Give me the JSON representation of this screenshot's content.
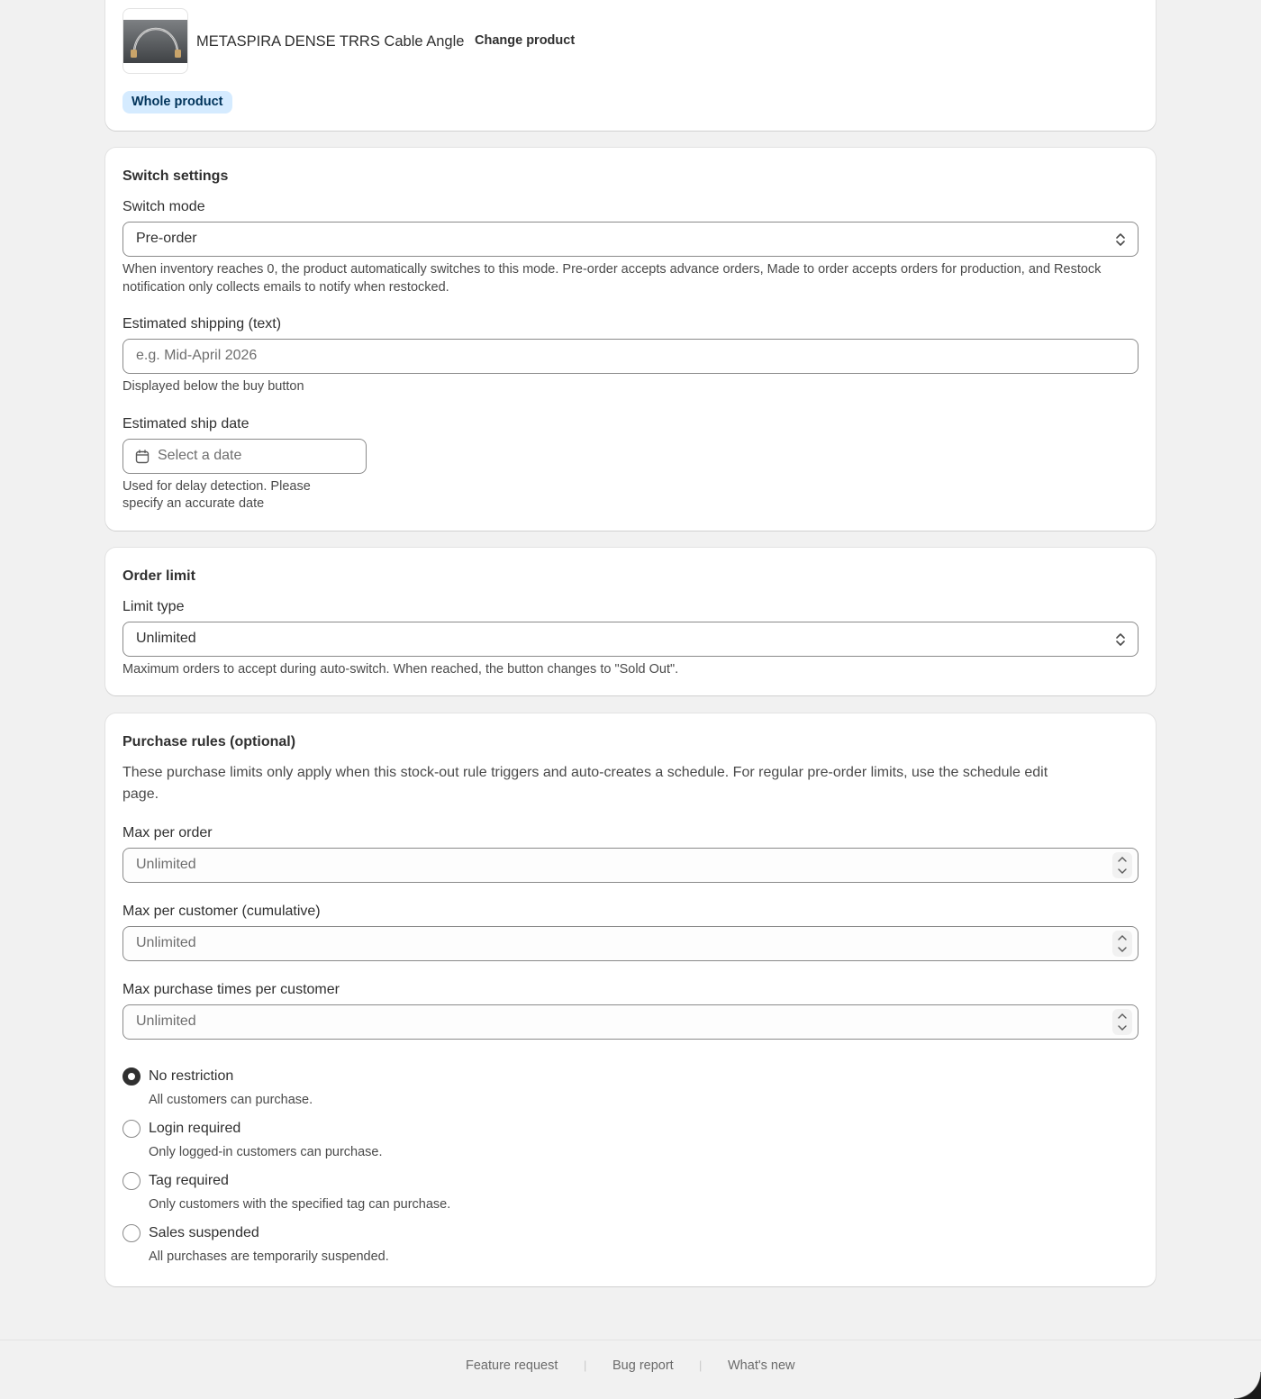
{
  "product": {
    "name": "METASPIRA DENSE TRRS Cable Angle",
    "change_label": "Change product",
    "scope_badge": "Whole product",
    "thumbnail_icon": "product-thumbnail-image"
  },
  "switch_settings": {
    "title": "Switch settings",
    "mode_label": "Switch mode",
    "mode_value": "Pre-order",
    "mode_help": "When inventory reaches 0, the product automatically switches to this mode. Pre-order accepts advance orders, Made to order accepts orders for production, and Restock notification only collects emails to notify when restocked.",
    "shipping_label": "Estimated shipping (text)",
    "shipping_placeholder": "e.g. Mid-April 2026",
    "shipping_help": "Displayed below the buy button",
    "ship_date_label": "Estimated ship date",
    "ship_date_placeholder": "Select a date",
    "ship_date_help_line1": "Used for delay detection. Please",
    "ship_date_help_line2": "specify an accurate date"
  },
  "order_limit": {
    "title": "Order limit",
    "limit_label": "Limit type",
    "limit_value": "Unlimited",
    "limit_help": "Maximum orders to accept during auto-switch. When reached, the button changes to \"Sold Out\"."
  },
  "purchase_rules": {
    "title": "Purchase rules (optional)",
    "description_line1": "These purchase limits only apply when this stock-out rule triggers and auto-creates a schedule. For regular pre-order limits, use the schedule edit",
    "description_line2": "page.",
    "max_per_order_label": "Max per order",
    "max_per_order_placeholder": "Unlimited",
    "max_per_customer_label": "Max per customer (cumulative)",
    "max_per_customer_placeholder": "Unlimited",
    "max_times_label": "Max purchase times per customer",
    "max_times_placeholder": "Unlimited",
    "options": [
      {
        "label": "No restriction",
        "help": "All customers can purchase.",
        "checked": true
      },
      {
        "label": "Login required",
        "help": "Only logged-in customers can purchase.",
        "checked": false
      },
      {
        "label": "Tag required",
        "help": "Only customers with the specified tag can purchase.",
        "checked": false
      },
      {
        "label": "Sales suspended",
        "help": "All purchases are temporarily suspended.",
        "checked": false
      }
    ]
  },
  "footer": {
    "links": [
      "Feature request",
      "Bug report",
      "What's new"
    ],
    "separator": "|"
  },
  "colors": {
    "background": "#f1f1f1",
    "card": "#ffffff",
    "badge_bg": "#d5ebff",
    "text": "#303030"
  }
}
